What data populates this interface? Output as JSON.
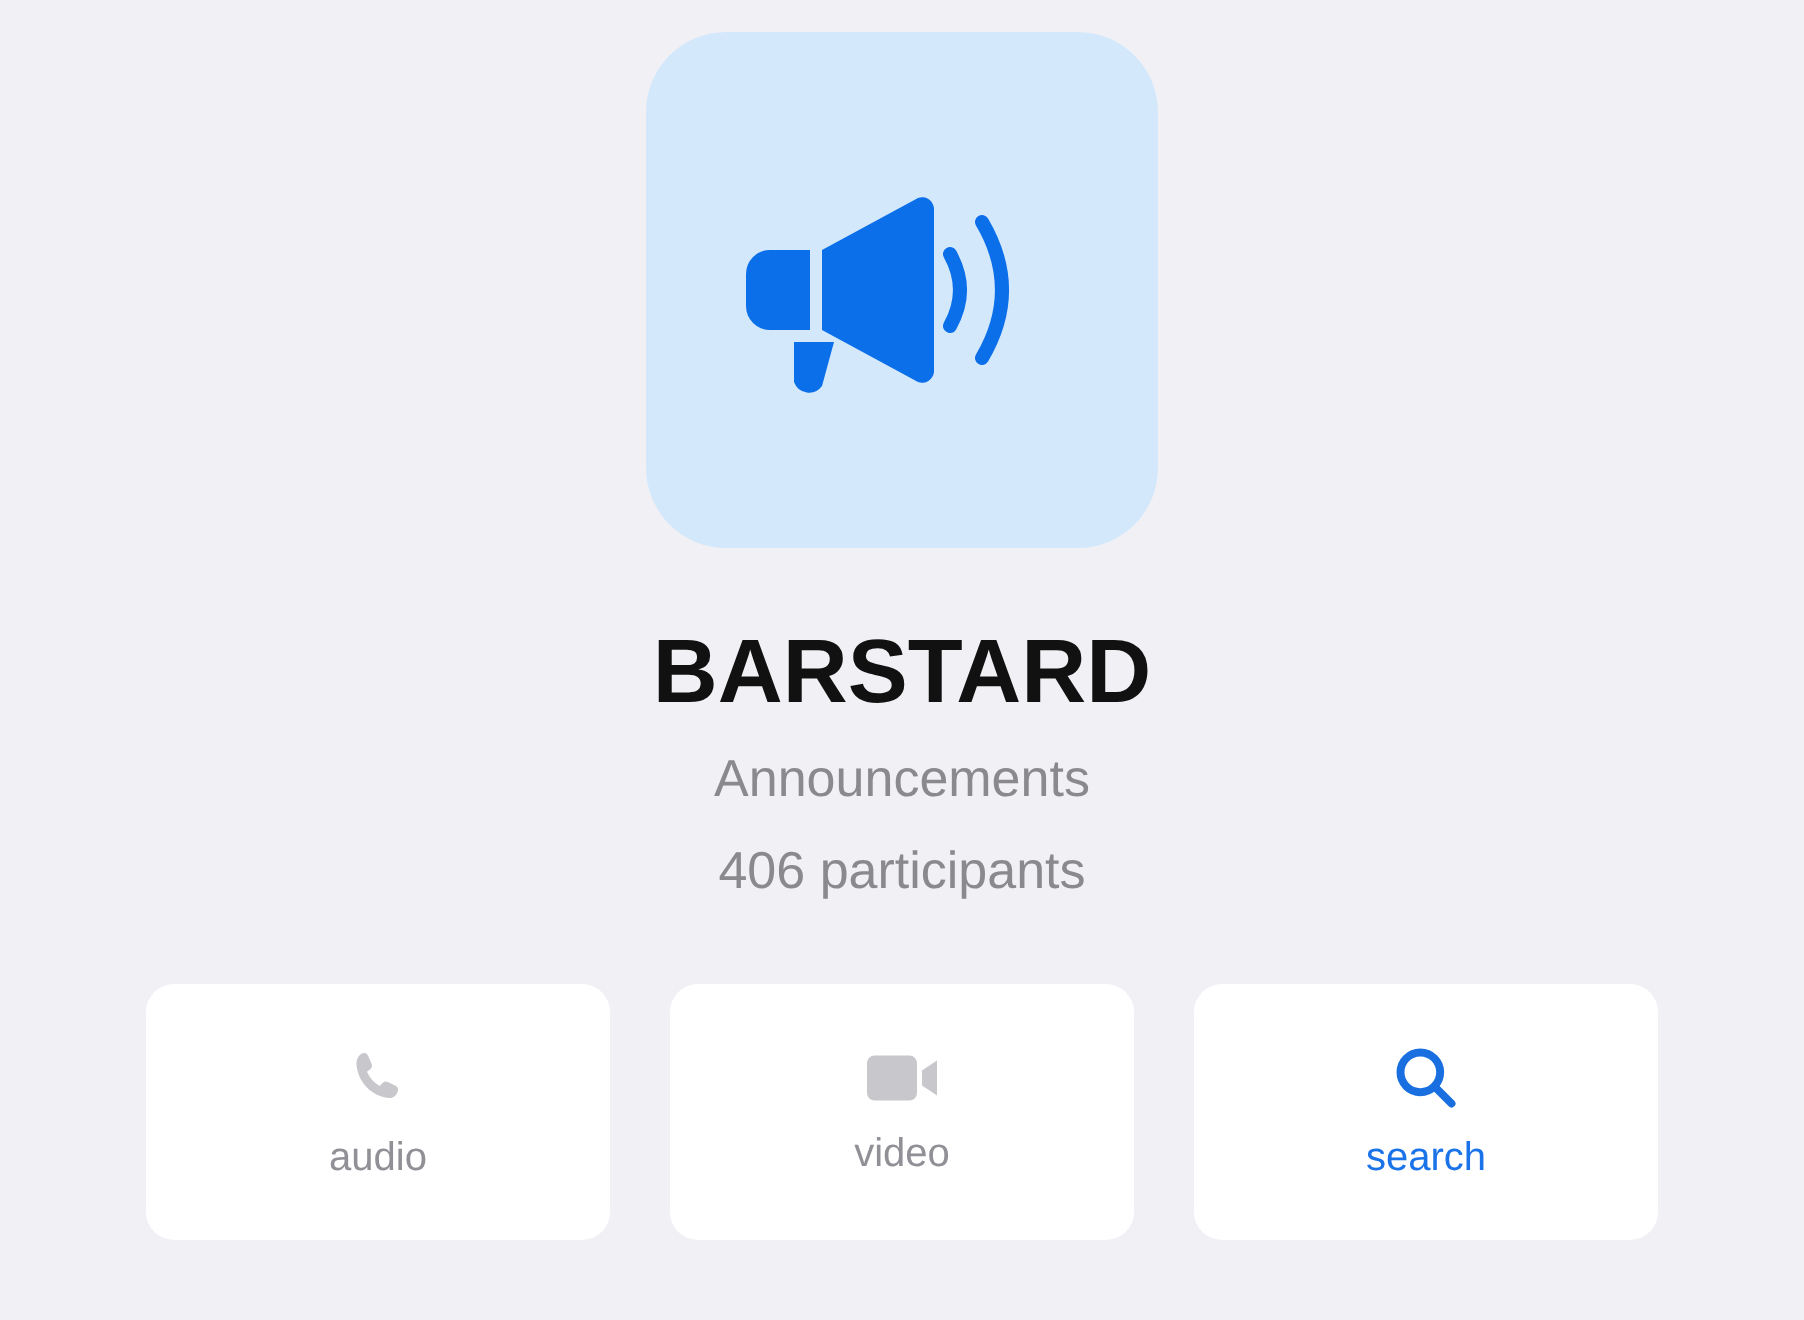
{
  "channel": {
    "name": "BARSTARD",
    "type": "Announcements",
    "participants": "406 participants"
  },
  "actions": [
    {
      "kind": "audio",
      "label": "audio",
      "disabled": true
    },
    {
      "kind": "video",
      "label": "video",
      "disabled": true
    },
    {
      "kind": "search",
      "label": "search",
      "disabled": false
    }
  ]
}
